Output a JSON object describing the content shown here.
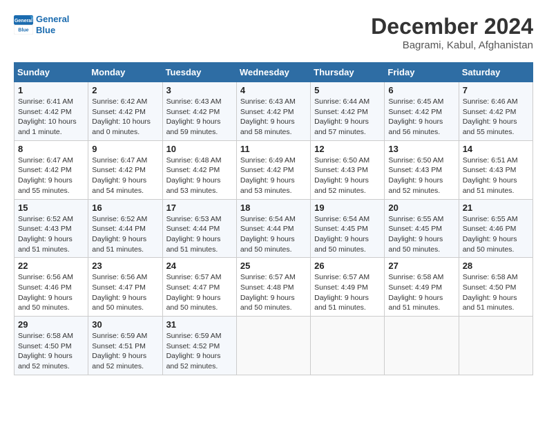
{
  "header": {
    "logo_line1": "General",
    "logo_line2": "Blue",
    "title": "December 2024",
    "subtitle": "Bagrami, Kabul, Afghanistan"
  },
  "days_of_week": [
    "Sunday",
    "Monday",
    "Tuesday",
    "Wednesday",
    "Thursday",
    "Friday",
    "Saturday"
  ],
  "weeks": [
    [
      {
        "day": "1",
        "sunrise": "6:41 AM",
        "sunset": "4:42 PM",
        "daylight": "10 hours and 1 minute."
      },
      {
        "day": "2",
        "sunrise": "6:42 AM",
        "sunset": "4:42 PM",
        "daylight": "10 hours and 0 minutes."
      },
      {
        "day": "3",
        "sunrise": "6:43 AM",
        "sunset": "4:42 PM",
        "daylight": "9 hours and 59 minutes."
      },
      {
        "day": "4",
        "sunrise": "6:43 AM",
        "sunset": "4:42 PM",
        "daylight": "9 hours and 58 minutes."
      },
      {
        "day": "5",
        "sunrise": "6:44 AM",
        "sunset": "4:42 PM",
        "daylight": "9 hours and 57 minutes."
      },
      {
        "day": "6",
        "sunrise": "6:45 AM",
        "sunset": "4:42 PM",
        "daylight": "9 hours and 56 minutes."
      },
      {
        "day": "7",
        "sunrise": "6:46 AM",
        "sunset": "4:42 PM",
        "daylight": "9 hours and 55 minutes."
      }
    ],
    [
      {
        "day": "8",
        "sunrise": "6:47 AM",
        "sunset": "4:42 PM",
        "daylight": "9 hours and 55 minutes."
      },
      {
        "day": "9",
        "sunrise": "6:47 AM",
        "sunset": "4:42 PM",
        "daylight": "9 hours and 54 minutes."
      },
      {
        "day": "10",
        "sunrise": "6:48 AM",
        "sunset": "4:42 PM",
        "daylight": "9 hours and 53 minutes."
      },
      {
        "day": "11",
        "sunrise": "6:49 AM",
        "sunset": "4:42 PM",
        "daylight": "9 hours and 53 minutes."
      },
      {
        "day": "12",
        "sunrise": "6:50 AM",
        "sunset": "4:43 PM",
        "daylight": "9 hours and 52 minutes."
      },
      {
        "day": "13",
        "sunrise": "6:50 AM",
        "sunset": "4:43 PM",
        "daylight": "9 hours and 52 minutes."
      },
      {
        "day": "14",
        "sunrise": "6:51 AM",
        "sunset": "4:43 PM",
        "daylight": "9 hours and 51 minutes."
      }
    ],
    [
      {
        "day": "15",
        "sunrise": "6:52 AM",
        "sunset": "4:43 PM",
        "daylight": "9 hours and 51 minutes."
      },
      {
        "day": "16",
        "sunrise": "6:52 AM",
        "sunset": "4:44 PM",
        "daylight": "9 hours and 51 minutes."
      },
      {
        "day": "17",
        "sunrise": "6:53 AM",
        "sunset": "4:44 PM",
        "daylight": "9 hours and 51 minutes."
      },
      {
        "day": "18",
        "sunrise": "6:54 AM",
        "sunset": "4:44 PM",
        "daylight": "9 hours and 50 minutes."
      },
      {
        "day": "19",
        "sunrise": "6:54 AM",
        "sunset": "4:45 PM",
        "daylight": "9 hours and 50 minutes."
      },
      {
        "day": "20",
        "sunrise": "6:55 AM",
        "sunset": "4:45 PM",
        "daylight": "9 hours and 50 minutes."
      },
      {
        "day": "21",
        "sunrise": "6:55 AM",
        "sunset": "4:46 PM",
        "daylight": "9 hours and 50 minutes."
      }
    ],
    [
      {
        "day": "22",
        "sunrise": "6:56 AM",
        "sunset": "4:46 PM",
        "daylight": "9 hours and 50 minutes."
      },
      {
        "day": "23",
        "sunrise": "6:56 AM",
        "sunset": "4:47 PM",
        "daylight": "9 hours and 50 minutes."
      },
      {
        "day": "24",
        "sunrise": "6:57 AM",
        "sunset": "4:47 PM",
        "daylight": "9 hours and 50 minutes."
      },
      {
        "day": "25",
        "sunrise": "6:57 AM",
        "sunset": "4:48 PM",
        "daylight": "9 hours and 50 minutes."
      },
      {
        "day": "26",
        "sunrise": "6:57 AM",
        "sunset": "4:49 PM",
        "daylight": "9 hours and 51 minutes."
      },
      {
        "day": "27",
        "sunrise": "6:58 AM",
        "sunset": "4:49 PM",
        "daylight": "9 hours and 51 minutes."
      },
      {
        "day": "28",
        "sunrise": "6:58 AM",
        "sunset": "4:50 PM",
        "daylight": "9 hours and 51 minutes."
      }
    ],
    [
      {
        "day": "29",
        "sunrise": "6:58 AM",
        "sunset": "4:50 PM",
        "daylight": "9 hours and 52 minutes."
      },
      {
        "day": "30",
        "sunrise": "6:59 AM",
        "sunset": "4:51 PM",
        "daylight": "9 hours and 52 minutes."
      },
      {
        "day": "31",
        "sunrise": "6:59 AM",
        "sunset": "4:52 PM",
        "daylight": "9 hours and 52 minutes."
      },
      null,
      null,
      null,
      null
    ]
  ],
  "labels": {
    "sunrise": "Sunrise:",
    "sunset": "Sunset:",
    "daylight": "Daylight:"
  }
}
